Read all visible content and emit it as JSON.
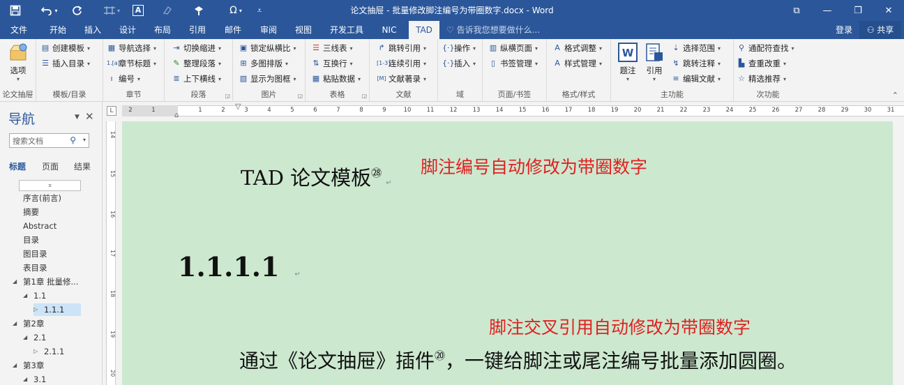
{
  "titlebar": {
    "title": "论文抽屉 - 批量修改脚注编号为带圈数字.docx - Word",
    "save_icon": "save-icon",
    "undo_icon": "undo-icon",
    "redo_icon": "redo-icon",
    "omega": "Ω",
    "min": "—",
    "max": "❐",
    "close": "✕",
    "ribbon_display": "⧉"
  },
  "tabs": [
    "文件",
    "开始",
    "插入",
    "设计",
    "布局",
    "引用",
    "邮件",
    "审阅",
    "视图",
    "开发工具",
    "NIC",
    "TAD"
  ],
  "active_tab": "TAD",
  "tell_me": "告诉我您想要做什么...",
  "login": "登录",
  "share": "共享",
  "ribbon": {
    "groups": {
      "g1": "论文抽屉",
      "g2": "模板/目录",
      "g3": "章节",
      "g4": "段落",
      "g5": "图片",
      "g6": "表格",
      "g7": "文献",
      "g8": "域",
      "g9": "页面/书签",
      "g10": "格式/样式",
      "g11": "主功能",
      "g12": "次功能"
    },
    "options": "选项",
    "create_template": "创建模板",
    "insert_toc": "插入目录",
    "nav_select": "导航选择",
    "chapter_title": "章节标题",
    "numbering": "编号",
    "toggle_indent": "切换缩进",
    "tidy_para": "整理段落",
    "hr_line": "上下横线",
    "lock_ratio": "锁定纵横比",
    "multi_layout": "多图排版",
    "show_frame": "显示为图框",
    "three_line": "三线表",
    "swap_row": "互换行",
    "paste_data": "粘贴数据",
    "jump_ref": "跳转引用",
    "cont_ref": "连续引用",
    "ref_list": "文献著录",
    "operate": "操作",
    "insert": "插入",
    "landscape": "纵横页面",
    "bookmark": "书签管理",
    "format_adjust": "格式调整",
    "style_mgr": "样式管理",
    "caption": "题注",
    "cite": "引用",
    "select_range": "选择范围",
    "jump_note": "跳转注释",
    "edit_ref": "编辑文献",
    "wildcard": "通配符查找",
    "dup_check": "查重改重",
    "recommend": "精选推荐"
  },
  "nav": {
    "title": "导航",
    "search_placeholder": "搜索文档",
    "tabs": [
      "标题",
      "页面",
      "结果"
    ],
    "items": [
      {
        "label": "序言(前言)"
      },
      {
        "label": "摘要"
      },
      {
        "label": "Abstract"
      },
      {
        "label": "目录"
      },
      {
        "label": "图目录"
      },
      {
        "label": "表目录"
      },
      {
        "label": "第1章 批量修..."
      },
      {
        "label": "1.1"
      },
      {
        "label": "1.1.1"
      },
      {
        "label": "第2章"
      },
      {
        "label": "2.1"
      },
      {
        "label": "2.1.1"
      },
      {
        "label": "第3章"
      },
      {
        "label": "3.1"
      }
    ]
  },
  "hruler": {
    "left_nums": [
      "2",
      "1"
    ],
    "nums": [
      "1",
      "2",
      "3",
      "4",
      "5",
      "6",
      "7",
      "8",
      "9",
      "10",
      "11",
      "12",
      "13",
      "14",
      "15",
      "16",
      "17",
      "18",
      "19",
      "20",
      "21",
      "22",
      "23",
      "24",
      "25",
      "26",
      "27",
      "28",
      "29",
      "30",
      "31"
    ]
  },
  "vruler": {
    "nums": [
      "14",
      "15",
      "16",
      "17",
      "18",
      "19",
      "20"
    ]
  },
  "document": {
    "title_text": "TAD 论文模板",
    "title_note": "㉘",
    "heading": "1.1.1.1",
    "body_text_1": "通过《论文抽屉》插件",
    "body_note": "⑳",
    "body_text_2": "，一键给脚注或尾注编号批量添加圆圈。",
    "anno_1": "脚注编号自动修改为带圈数字",
    "anno_2": "脚注交叉引用自动修改为带圈数字",
    "para_mark": "↵"
  },
  "colors": {
    "accent": "#2b579a",
    "doc_bg": "#cce8cf",
    "annotation": "#e02020"
  }
}
